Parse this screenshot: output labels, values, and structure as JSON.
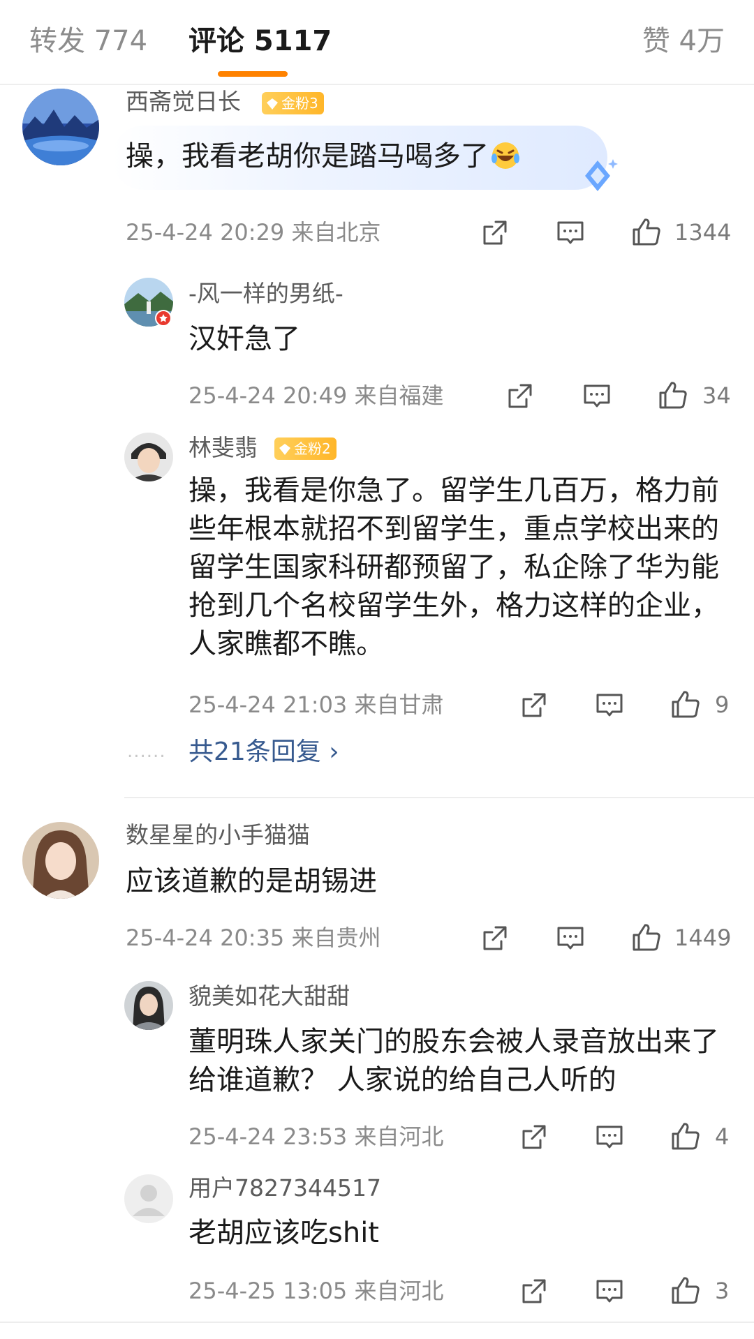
{
  "tabs": {
    "forward": "转发 774",
    "comments": "评论 5117",
    "likes": "赞 4万"
  },
  "colors": {
    "accent": "#ff8200",
    "link": "#375a8f",
    "badge": "#ffb629"
  },
  "comments": [
    {
      "user": "西斋觉日长",
      "badge": "金粉3",
      "text": "操，我看老胡你是踏马喝多了",
      "emoji": "laughing-tears-emoji",
      "meta": "25-4-24 20:29  来自北京",
      "likes": "1344",
      "replies": [
        {
          "user": "-风一样的男纸-",
          "text": "汉奸急了",
          "meta": "25-4-24 20:49  来自福建",
          "likes": "34"
        },
        {
          "user": "林斐翡",
          "badge": "金粉2",
          "text": "操，我看是你急了。留学生几百万，格力前些年根本就招不到留学生，重点学校出来的留学生国家科研都预留了，私企除了华为能抢到几个名校留学生外，格力这样的企业，人家瞧都不瞧。",
          "meta": "25-4-24 21:03  来自甘肃",
          "likes": "9"
        }
      ],
      "more_replies": "共21条回复 ›"
    },
    {
      "user": "数星星的小手猫猫",
      "text": "应该道歉的是胡锡进",
      "meta": "25-4-24 20:35  来自贵州",
      "likes": "1449",
      "replies": [
        {
          "user": "貌美如花大甜甜",
          "text": "董明珠人家关门的股东会被人录音放出来了 给谁道歉？ 人家说的给自己人听的",
          "meta": "25-4-24 23:53  来自河北",
          "likes": "4"
        },
        {
          "user": "用户7827344517",
          "text": "老胡应该吃shit",
          "meta": "25-4-25 13:05  来自河北",
          "likes": "3"
        }
      ]
    }
  ]
}
